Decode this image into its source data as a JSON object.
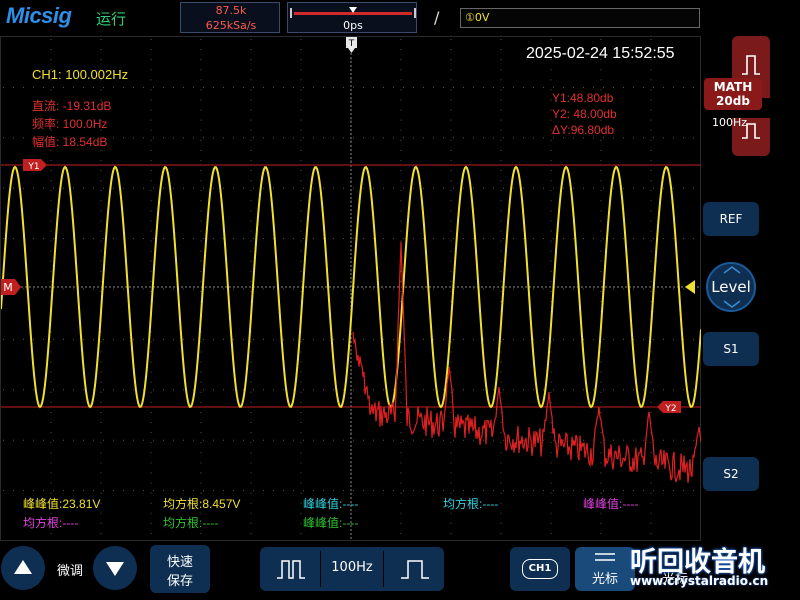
{
  "header": {
    "brand": "Micsig",
    "run_status": "运行",
    "memory_depth": "87.5k",
    "sample_rate": "625kSa/s",
    "time_offset": "0ps",
    "trigger_slope": "/",
    "trigger_level": "①0V"
  },
  "screen": {
    "datetime": "2025-02-24 15:52:55",
    "ch1_frequency": "CH1: 100.002Hz",
    "math_measure": [
      "直流: -19.31dB",
      "频率: 100.0Hz",
      "幅值: 18.54dB"
    ],
    "cursor_readout": [
      "Y1:48.80db",
      "Y2: 48.00db",
      "ΔY:96.80db"
    ],
    "cursor_y1_tag": "Y1",
    "cursor_y2_tag": "Y2",
    "math_marker": "M",
    "measurements_row1": [
      {
        "label": "峰峰值:23.81V",
        "color": "#f0e030"
      },
      {
        "label": "均方根:8.457V",
        "color": "#f0e030"
      },
      {
        "label": "峰峰值:----",
        "color": "#30d0e0"
      },
      {
        "label": "均方根:----",
        "color": "#30d0e0"
      },
      {
        "label": "峰峰值:----",
        "color": "#e040e0"
      }
    ],
    "measurements_row2": [
      {
        "label": "均方根:----",
        "color": "#e040e0"
      },
      {
        "label": "均方根:----",
        "color": "#30c030"
      },
      {
        "label": "峰峰值:----",
        "color": "#30c030"
      }
    ]
  },
  "right_panel": {
    "math_label": "MATH",
    "math_scale": "20db",
    "math_freq": "100Hz",
    "ref_label": "REF",
    "level_label": "Level",
    "s1_label": "S1",
    "s2_label": "S2"
  },
  "bottom": {
    "fine_label": "微调",
    "quick_save_l1": "快速",
    "quick_save_l2": "保存",
    "freq_value": "100Hz",
    "ch1_label": "CH1",
    "cursor_label": "光标",
    "cursor_label2": "光标",
    "watermark": "听回收音机",
    "watermark_url": "www.crystalradio.cn"
  },
  "colors": {
    "ch1": "#f0e030",
    "math": "#e02020",
    "accent": "#0e2f52"
  }
}
